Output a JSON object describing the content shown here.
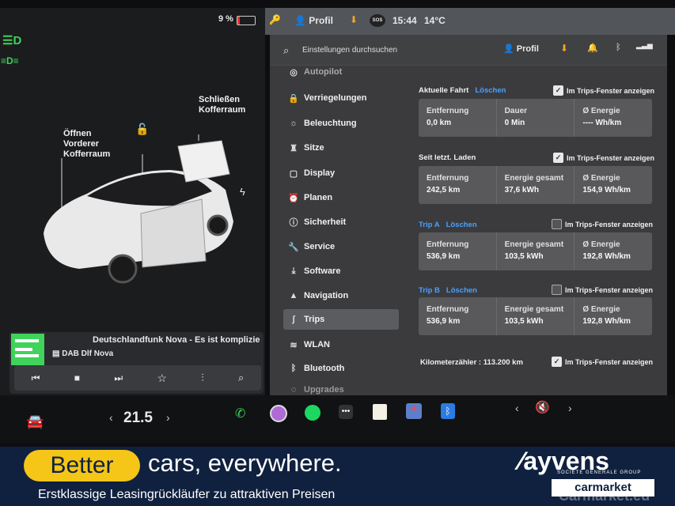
{
  "status": {
    "battery": "9 %",
    "profile": "Profil",
    "sos": "SOS",
    "time": "15:44",
    "temp": "14°C"
  },
  "car": {
    "label_front": [
      "Öffnen",
      "Vorderer",
      "Kofferraum"
    ],
    "label_rear": [
      "Schließen",
      "Kofferraum"
    ]
  },
  "media": {
    "title": "Deutschlandfunk Nova - Es ist komplizie",
    "station": "DAB Dlf Nova"
  },
  "search": {
    "placeholder": "Einstellungen durchsuchen",
    "profile": "Profil"
  },
  "nav": {
    "partial_top": "Autopilot",
    "items": [
      "Verriegelungen",
      "Beleuchtung",
      "Sitze",
      "Display",
      "Planen",
      "Sicherheit",
      "Service",
      "Software",
      "Navigation",
      "Trips",
      "WLAN",
      "Bluetooth"
    ],
    "partial_bottom": "Upgrades"
  },
  "trips": {
    "current": {
      "title": "Aktuelle Fahrt",
      "link": "Löschen",
      "check": "Im Trips-Fenster anzeigen",
      "cells": [
        {
          "label": "Entfernung",
          "value": "0,0 km"
        },
        {
          "label": "Dauer",
          "value": "0 Min"
        },
        {
          "label": "Ø Energie",
          "value": "---- Wh/km"
        }
      ]
    },
    "since_charge": {
      "title": "Seit letzt. Laden",
      "check": "Im Trips-Fenster anzeigen",
      "cells": [
        {
          "label": "Entfernung",
          "value": "242,5 km"
        },
        {
          "label": "Energie gesamt",
          "value": "37,6 kWh"
        },
        {
          "label": "Ø Energie",
          "value": "154,9 Wh/km"
        }
      ]
    },
    "trip_a": {
      "title": "Trip A",
      "link": "Löschen",
      "check": "Im Trips-Fenster anzeigen",
      "cells": [
        {
          "label": "Entfernung",
          "value": "536,9 km"
        },
        {
          "label": "Energie gesamt",
          "value": "103,5 kWh"
        },
        {
          "label": "Ø Energie",
          "value": "192,8 Wh/km"
        }
      ]
    },
    "trip_b": {
      "title": "Trip B",
      "link": "Löschen",
      "check": "Im Trips-Fenster anzeigen",
      "cells": [
        {
          "label": "Entfernung",
          "value": "536,9 km"
        },
        {
          "label": "Energie gesamt",
          "value": "103,5 kWh"
        },
        {
          "label": "Ø Energie",
          "value": "192,8 Wh/km"
        }
      ]
    },
    "odometer": {
      "text": "Kilometerzähler : 113.200 km",
      "check": "Im Trips-Fenster anzeigen"
    }
  },
  "dock": {
    "temperature": "21.5"
  },
  "banner": {
    "badge": "Better",
    "headline": "cars, everywhere.",
    "subline": "Erstklassige Leasingrückläufer zu attraktiven Preisen",
    "brand": "ayvens",
    "brand_sub": "SOCIETE GENERALE GROUP",
    "market": "carmarket",
    "watermark": "Carmarket.eu"
  },
  "colors": {
    "accent": "#4aa0ff",
    "banner_bg": "#10213f",
    "badge": "#f5c518",
    "green": "#3fd35a"
  }
}
